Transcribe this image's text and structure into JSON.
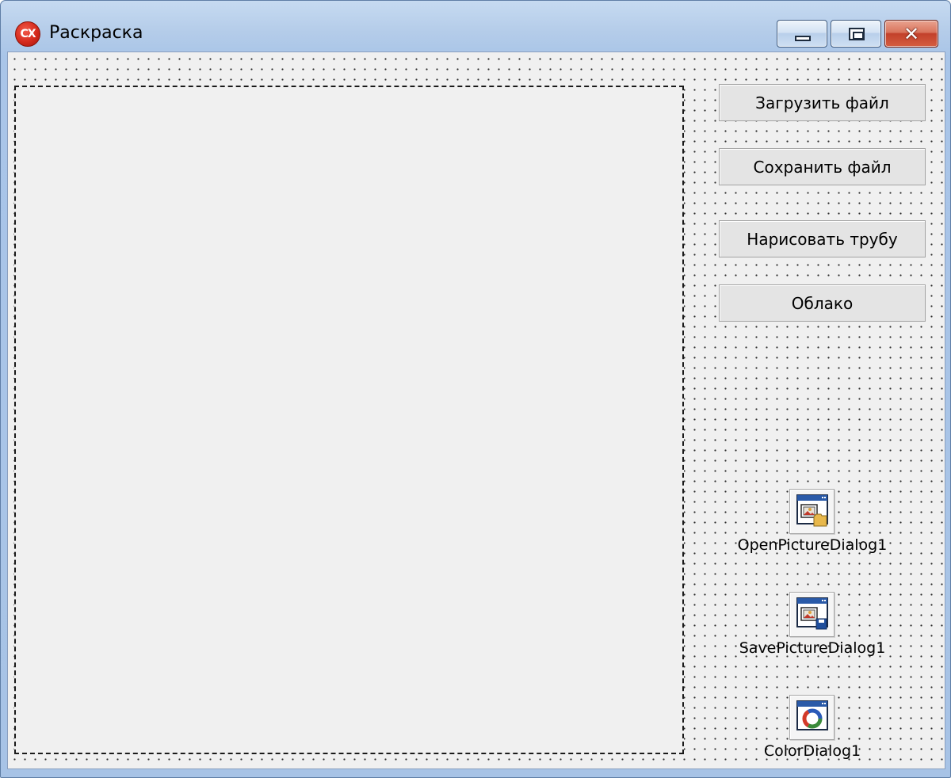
{
  "window": {
    "title": "Раскраска",
    "app_icon_text": "CX",
    "app_icon_name": "cx-app-icon",
    "accent_color": "#d52a1c"
  },
  "caption_buttons": {
    "minimize_icon": "minimize-icon",
    "maximize_icon": "maximize-icon",
    "close_icon": "close-icon",
    "close_glyph": "✕"
  },
  "form": {
    "buttons": [
      {
        "label": "Загрузить файл"
      },
      {
        "label": "Сохранить файл"
      },
      {
        "label": "Нарисовать трубу"
      },
      {
        "label": "Облако"
      }
    ],
    "components": [
      {
        "label": "OpenPictureDialog1",
        "icon": "open-picture-dialog-icon"
      },
      {
        "label": "SavePictureDialog1",
        "icon": "save-picture-dialog-icon"
      },
      {
        "label": "ColorDialog1",
        "icon": "color-dialog-icon"
      }
    ]
  }
}
